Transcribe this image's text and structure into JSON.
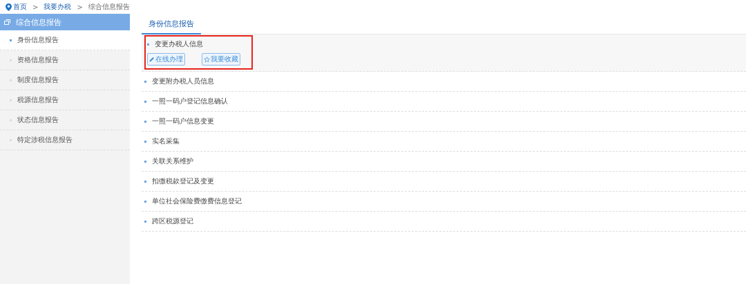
{
  "breadcrumb": [
    {
      "label": "首页",
      "kind": "home"
    },
    {
      "label": ">",
      "kind": "separator"
    },
    {
      "label": "我要办税",
      "kind": "link"
    },
    {
      "label": ">",
      "kind": "separator"
    },
    {
      "label": "综合信息报告",
      "kind": "current"
    }
  ],
  "sidebar": {
    "title": "综合信息报告",
    "items": [
      {
        "label": "身份信息报告",
        "selected": true
      },
      {
        "label": "资格信息报告",
        "selected": false
      },
      {
        "label": "制度信息报告",
        "selected": false
      },
      {
        "label": "税源信息报告",
        "selected": false
      },
      {
        "label": "状态信息报告",
        "selected": false
      },
      {
        "label": "特定涉税信息报告",
        "selected": false
      }
    ]
  },
  "tabs": [
    {
      "label": "身份信息报告",
      "selected": true
    }
  ],
  "items": [
    {
      "label": "变更办税人信息",
      "expanded": true,
      "highlighted": true,
      "actions": [
        {
          "label": "在线办理",
          "kind": "edit"
        },
        {
          "label": "我要收藏",
          "kind": "star"
        }
      ]
    },
    {
      "label": "变更附办税人员信息",
      "expanded": false,
      "highlighted": false
    },
    {
      "label": "一照一码户登记信息确认",
      "expanded": false,
      "highlighted": false
    },
    {
      "label": "一照一码户信息变更",
      "expanded": false,
      "highlighted": false
    },
    {
      "label": "实名采集",
      "expanded": false,
      "highlighted": false
    },
    {
      "label": "关联关系维护",
      "expanded": false,
      "highlighted": false
    },
    {
      "label": "扣缴税款登记及变更",
      "expanded": false,
      "highlighted": false
    },
    {
      "label": "单位社会保险费缴费信息登记",
      "expanded": false,
      "highlighted": false
    },
    {
      "label": "跨区税源登记",
      "expanded": false,
      "highlighted": false
    }
  ]
}
